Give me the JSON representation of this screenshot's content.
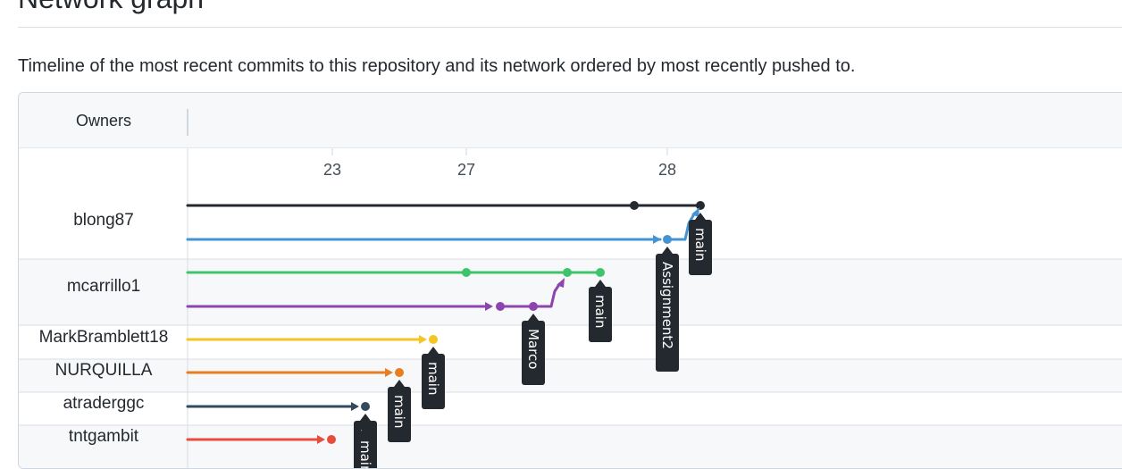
{
  "page": {
    "title": "Network graph",
    "subtitle": "Timeline of the most recent commits to this repository and its network ordered by most recently pushed to."
  },
  "graph": {
    "owners_header": "Owners",
    "date_ticks": [
      "23",
      "27",
      "28"
    ],
    "owners": [
      "blong87",
      "mcarrillo1",
      "MarkBramblett18",
      "NURQUILLA",
      "atraderggc",
      "tntgambit"
    ],
    "branches": [
      {
        "owner": "blong87",
        "color": "#24292f",
        "ref": ""
      },
      {
        "owner": "blong87",
        "color": "#4493d2",
        "ref": "Assignment2"
      },
      {
        "owner": "mcarrillo1",
        "color": "#3fc46d",
        "ref": "main"
      },
      {
        "owner": "mcarrillo1",
        "color": "#8e44ad",
        "ref": "Marco"
      },
      {
        "owner": "MarkBramblett18",
        "color": "#f3c623",
        "ref": "main"
      },
      {
        "owner": "NURQUILLA",
        "color": "#e67e22",
        "ref": "main"
      },
      {
        "owner": "atraderggc",
        "color": "#34495e",
        "ref": "main"
      },
      {
        "owner": "tntgambit",
        "color": "#e74c3c",
        "ref": "main"
      }
    ],
    "head_ref": "main"
  }
}
